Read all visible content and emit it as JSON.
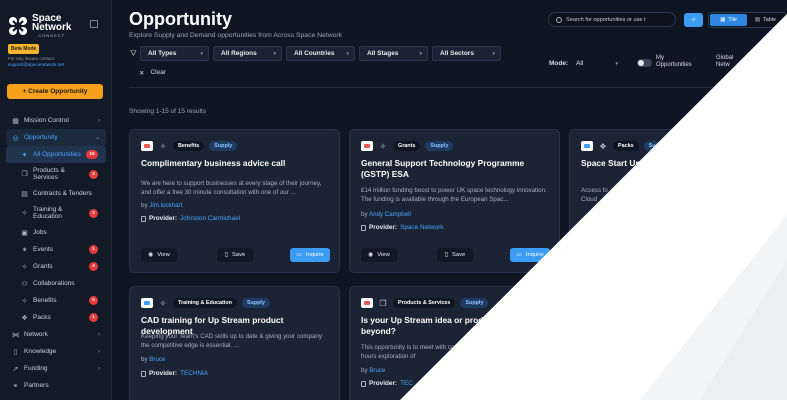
{
  "brand": {
    "name_line1": "Space",
    "name_line2": "Network",
    "name_sub": "CONNECT"
  },
  "beta_label": "Beta Mode",
  "contact": {
    "text": "For any issues contact",
    "email": "support@spacenetwork.net"
  },
  "create_button": "+  Create Opportunity",
  "nav": {
    "mission_control": "Mission Control",
    "opportunity": "Opportunity",
    "subs": [
      {
        "label": "All Opportunities",
        "badge": "15"
      },
      {
        "label": "Products & Services",
        "badge": "2"
      },
      {
        "label": "Contracts & Tenders",
        "badge": ""
      },
      {
        "label": "Training & Education",
        "badge": "2"
      },
      {
        "label": "Jobs",
        "badge": ""
      },
      {
        "label": "Events",
        "badge": "1"
      },
      {
        "label": "Grants",
        "badge": "4"
      },
      {
        "label": "Collaborations",
        "badge": ""
      },
      {
        "label": "Benefits",
        "badge": "5"
      },
      {
        "label": "Packs",
        "badge": "1"
      }
    ],
    "network": "Network",
    "knowledge": "Knowledge",
    "funding": "Funding",
    "partners": "Partners"
  },
  "header": {
    "title": "Opportunity",
    "subtitle": "Explore Supply and Demand opportunities from Across Space Network",
    "search_placeholder": "Search for opportunities or use t",
    "view_tile": "Tile",
    "view_table": "Table"
  },
  "filters": {
    "types": "All Types",
    "regions": "All Regions",
    "countries": "All Countries",
    "stages": "All Stages",
    "sectors": "All Sectors",
    "clear": "Clear",
    "mode_label": "Mode:",
    "mode_value": "All",
    "my_opportunities_l1": "My",
    "my_opportunities_l2": "Opportunities",
    "global_l1": "Global",
    "global_l2": "Netw"
  },
  "results_text": "Showing 1-15 of 15 results",
  "cards": [
    {
      "category": "Benefits",
      "kind": "Supply",
      "title": "Complimentary business advice call",
      "desc": "We are here to support businesses at every stage of their journey, and offer a free 30 minute consultation with one of our ...",
      "by_label": "by",
      "author": "Jim.lockhart",
      "provider_label": "Provider:",
      "provider": "Johnston Carmichael",
      "view": "View",
      "save": "Save",
      "inquire": "Inquire"
    },
    {
      "category": "Grants",
      "kind": "Supply",
      "title": "General Support Technology Programme (GSTP) ESA",
      "desc": "£14 million funding boost to power UK space technology innovation. The funding is available through the European Spac...",
      "by_label": "by",
      "author": "Andy Campbell",
      "provider_label": "Provider:",
      "provider": "Space Network",
      "view": "View",
      "save": "Save",
      "inquire": "Inquire"
    },
    {
      "category": "Packs",
      "kind": "Su",
      "title": "Space Start Ups toolx",
      "desc": "Access fo Cloud",
      "by_label": "by",
      "author": "",
      "provider_label": "",
      "provider": "",
      "view": "",
      "save": "",
      "inquire": ""
    },
    {
      "category": "Training & Education",
      "kind": "Supply",
      "title": "CAD training for Up Stream product development",
      "desc": "Keeping your Team's CAD skills up to date & giving your company the competitive edge is essential. ...",
      "by_label": "by",
      "author": "Bruce",
      "provider_label": "Provider:",
      "provider": "TECHNIA",
      "view": "",
      "save": "",
      "inquire": ""
    },
    {
      "category": "Products & Services",
      "kind": "Supply",
      "title": "Is your Up Stream idea or product fit beyond?",
      "desc": "This  opportunity is to meet with couple of hours exploration of",
      "by_label": "by",
      "author": "Bruce",
      "provider_label": "Provider:",
      "provider": "TEC",
      "view": "",
      "save": "",
      "inquire": ""
    }
  ]
}
